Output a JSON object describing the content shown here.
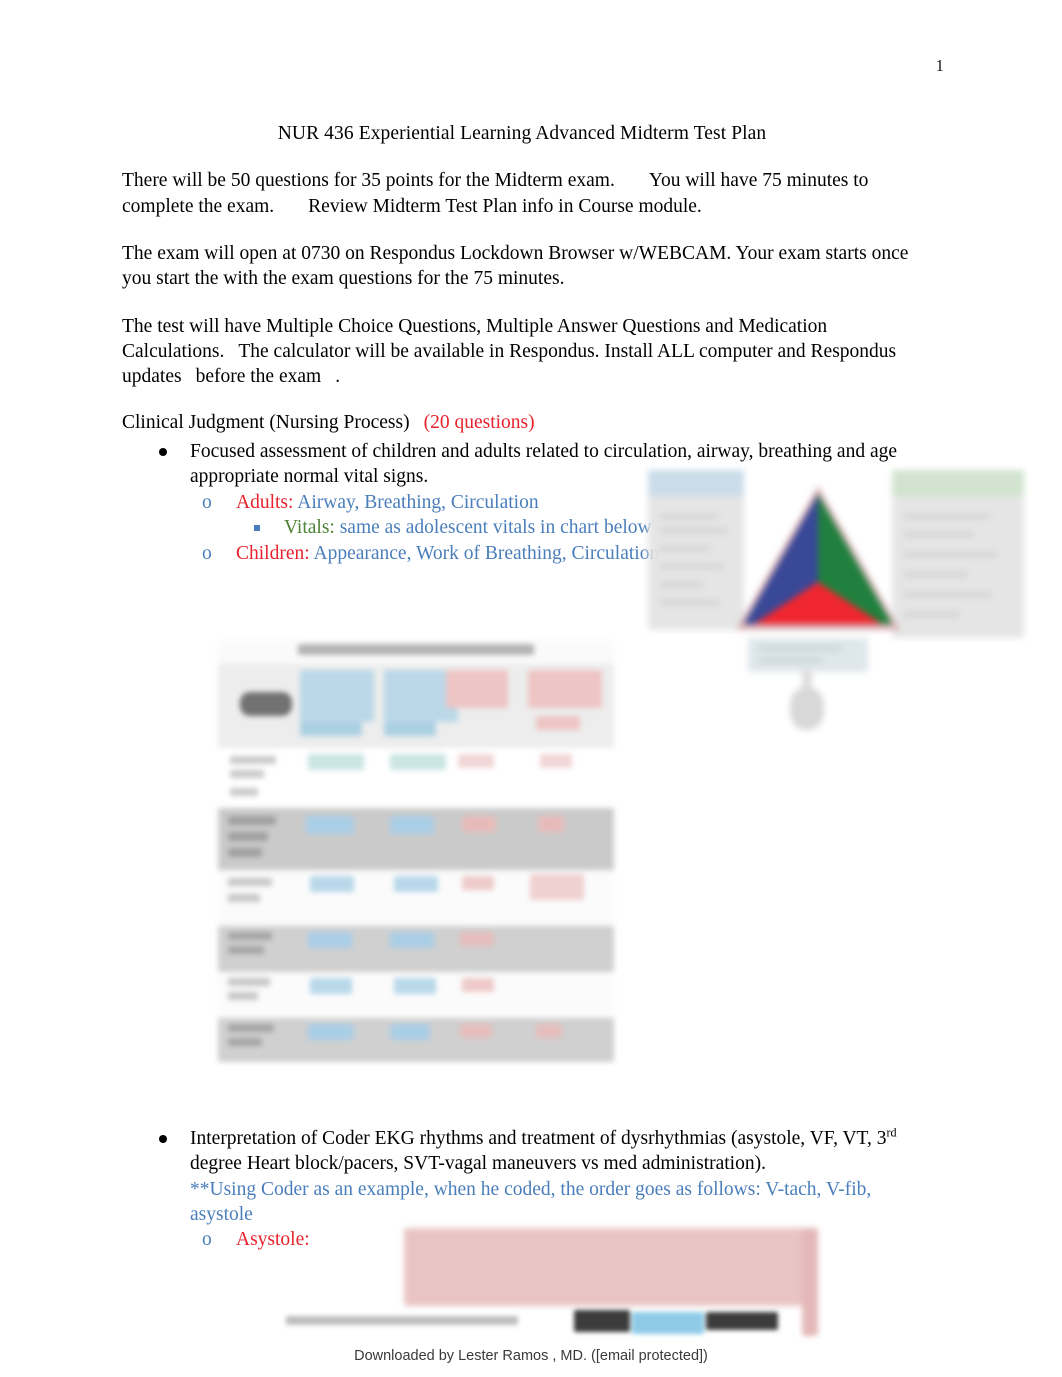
{
  "page": {
    "number": "1",
    "title": "NUR 436 Experiential Learning Advanced Midterm Test Plan"
  },
  "paragraphs": {
    "p1_a": "There will be 50 questions for 35 points for the Midterm exam.",
    "p1_b": "You will have 75 minutes to complete the exam.",
    "p1_c": "Review Midterm Test Plan info in Course module.",
    "p2": "The exam will open at 0730 on Respondus Lockdown Browser w/WEBCAM. Your exam starts once you start the with the exam questions for the 75 minutes.",
    "p3_a": "The test will have Multiple Choice Questions, Multiple Answer Questions and Medication Calculations.",
    "p3_b": "The calculator will be available in Respondus. Install ALL computer and Respondus updates",
    "p3_c": "before the exam",
    "p3_d": "."
  },
  "section1": {
    "heading": "Clinical Judgment (Nursing Process)",
    "question_count": "(20 questions)",
    "bullet1": "Focused assessment of children and adults related to circulation, airway, breathing and age appropriate normal vital signs.",
    "adults_label": "Adults:",
    "adults_value": "Airway, Breathing, Circulation",
    "vitals_label": "Vitals:",
    "vitals_value": "same as adolescent vitals in chart below",
    "children_label": "Children:",
    "children_value": "Appearance, Work of Breathing, Circulation",
    "marker_o": "o"
  },
  "section2": {
    "bullet_part1": "Interpretation of Coder EKG rhythms and treatment of dysrhythmias (asystole, VF, VT, 3",
    "bullet_ordinal": "rd",
    "bullet_part2": " degree Heart block/pacers, SVT-vagal maneuvers vs med administration).",
    "note": "**Using Coder as an example, when he coded, the order goes as follows: V-tach, V-fib, asystole",
    "asystole_label": "Asystole:",
    "marker_o": "o"
  },
  "figures": {
    "pediatric_assessment_triangle": {
      "alt": "Pediatric Assessment Triangle diagram (blurred)",
      "appearance_color": "#2f3f92",
      "work_of_breathing_color": "#157a34",
      "circulation_color": "#ef1b24"
    },
    "vital_signs_chart": {
      "alt": "Normal vital signs by age chart (blurred)",
      "columns": 5,
      "rows": 8
    },
    "ekg_strip": {
      "alt": "Asystole EKG rhythm strip (blurred)",
      "color": "#e9c4c4"
    }
  },
  "footer": {
    "text": "Downloaded by Lester Ramos , MD. ([email protected])"
  },
  "colors": {
    "red": "#e8222c",
    "blue": "#4a7ebb",
    "green": "#4e8234",
    "text": "#000000"
  }
}
